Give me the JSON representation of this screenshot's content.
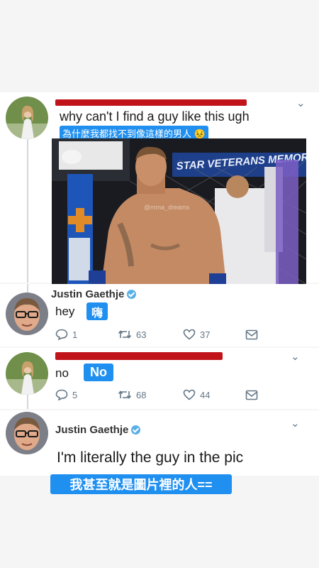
{
  "tweet1": {
    "text": "why can't I find a guy like this ugh",
    "translation": "為什麼我都找不到像這樣的男人 😣",
    "photo_watermark": "@mma_dreams",
    "banner_text": "STAR VETERANS MEMORIAL"
  },
  "reply1": {
    "name": "Justin Gaethje",
    "text": "hey",
    "translation": "嗨",
    "replies": "1",
    "retweets": "63",
    "likes": "37"
  },
  "reply2": {
    "text": "no",
    "translation": "No",
    "replies": "5",
    "retweets": "68",
    "likes": "44"
  },
  "reply3": {
    "name": "Justin Gaethje",
    "text": "I'm literally the guy in the pic",
    "translation": "我甚至就是圖片裡的人=="
  },
  "colors": {
    "translation_bg": "#1f8ff0",
    "redaction": "#c0141a",
    "verified": "#5ab0e8",
    "meta_gray": "#657786"
  }
}
